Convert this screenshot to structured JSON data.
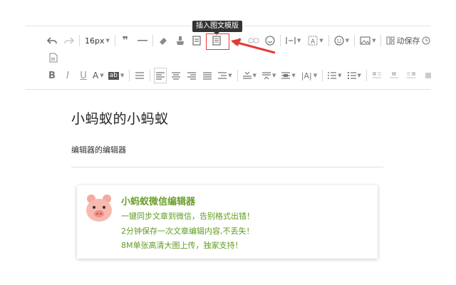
{
  "toolbar": {
    "font_size": "16px",
    "auto_save_label": "动保存",
    "tooltip": "插入图文模版"
  },
  "document": {
    "title": "小蚂蚁的小蚂蚁",
    "paragraph": "编辑器的编辑器"
  },
  "card": {
    "title": "小蚂蚁微信编辑器",
    "lines": [
      "一键同步文章到微信，告别格式出错！",
      "2分钟保存一次文章编辑内容,不丢失！",
      "8M单张高清大图上传，独家支持！"
    ]
  },
  "colors": {
    "accent_red": "#e53935",
    "card_green": "#6b9e2c",
    "pig_pink": "#f6a9a0"
  },
  "icons": [
    "undo-icon",
    "redo-icon",
    "quote-icon",
    "horizontal-rule-icon",
    "eraser-icon",
    "format-brush-icon",
    "insert-template-icon",
    "template-icon",
    "pen-icon",
    "link-icon",
    "emoji-icon",
    "indent-icon",
    "text-style-icon",
    "smile-icon",
    "image-icon",
    "autosave-icon",
    "clock-icon",
    "word-icon",
    "bold-icon",
    "italic-icon",
    "underline-icon",
    "font-color-icon",
    "bg-color-icon"
  ]
}
